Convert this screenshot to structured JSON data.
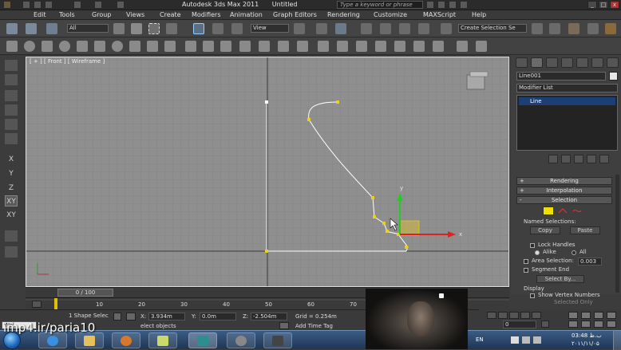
{
  "window": {
    "app_name": "Autodesk 3ds Max  2011",
    "document": "Untitled",
    "search_placeholder": "Type a keyword or phrase"
  },
  "menu": [
    "Edit",
    "Tools",
    "Group",
    "Views",
    "Create",
    "Modifiers",
    "Animation",
    "Graph Editors",
    "Rendering",
    "Customize",
    "MAXScript",
    "Help"
  ],
  "toolbar": {
    "selection_filter": "All",
    "reference_coord": "View",
    "named_selection": "Create Selection Se"
  },
  "left_tools": [
    "X",
    "Y",
    "Z",
    "XY",
    "XY"
  ],
  "viewport": {
    "label": "[ + ] [ Front ] [ Wireframe ]"
  },
  "command_panel": {
    "object_name": "Line001",
    "modifier_list": "Modifier List",
    "stack_item": "Line",
    "rollouts": {
      "rendering": "Rendering",
      "interpolation": "Interpolation",
      "selection": "Selection"
    },
    "named_selections_label": "Named Selections:",
    "copy_label": "Copy",
    "paste_label": "Paste",
    "lock_handles": "Lock Handles",
    "alike": "Alike",
    "all": "All",
    "area_selection": "Area Selection:",
    "area_value": "0.003",
    "segment_end": "Segment End",
    "select_by": "Select By...",
    "display": "Display",
    "show_vertex_numbers": "Show Vertex Numbers",
    "selected_only": "Selected Only"
  },
  "timeline": {
    "slider": "0 / 100",
    "ticks": [
      "10",
      "20",
      "30",
      "40",
      "50",
      "60",
      "70"
    ]
  },
  "status": {
    "selection_count": "1 Shape Selec",
    "x_label": "X:",
    "x_value": "3.934m",
    "y_label": "Y:",
    "y_value": "0.0m",
    "z_label": "Z:",
    "z_value": "-2.504m",
    "grid": "Grid = 0.254m",
    "prompt": "elect objects",
    "add_time_tag": "Add Time Tag",
    "welcome": "Wel",
    "frame_field": "0"
  },
  "taskbar": {
    "language": "EN",
    "time": "03:48 ب.ظ",
    "date": "۲۰۱۱/۱۱/۰۵"
  },
  "watermark": "imp4.ir/paria10"
}
